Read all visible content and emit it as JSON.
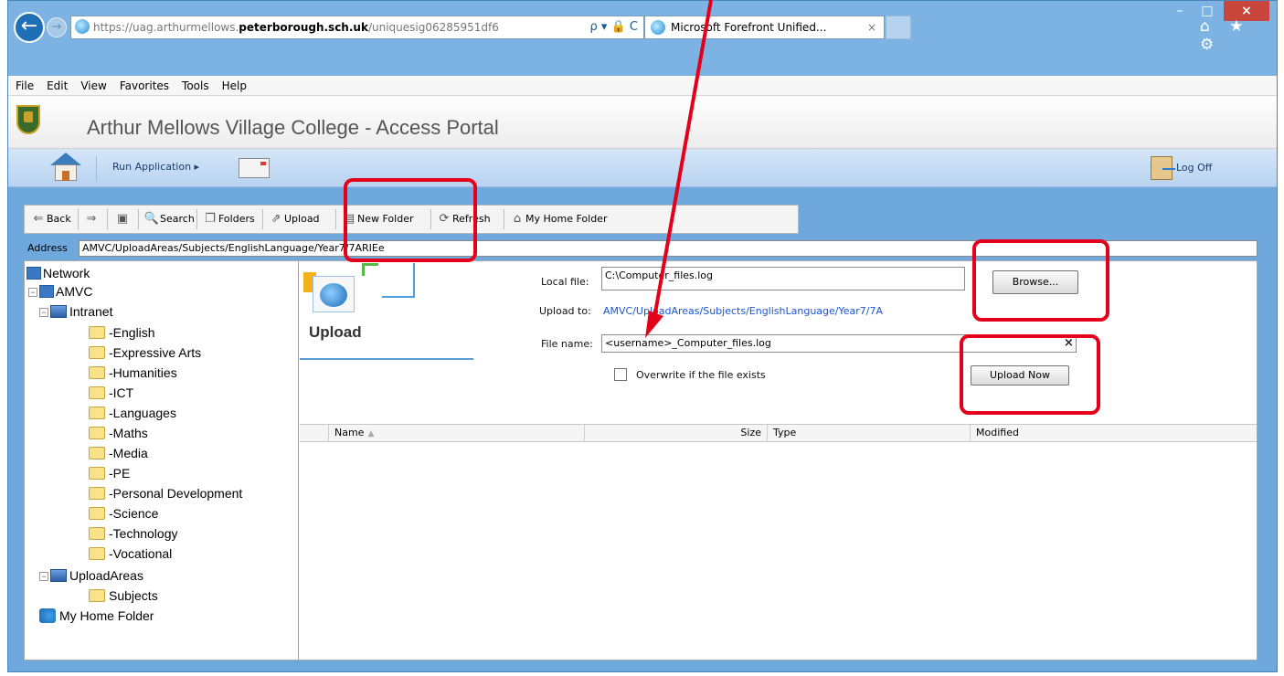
{
  "browser": {
    "url": {
      "scheme": "https://",
      "host_pre": "uag.arthurmellows.",
      "host": "peterborough.sch.uk",
      "path": "/uniquesig06285951df6",
      "controls": "ρ ▾ 🔒 C"
    },
    "tab_title": "Microsoft Forefront Unified...",
    "tab_close": "×",
    "window_controls": {
      "minimize": "–",
      "maximize": "□",
      "close": "×"
    },
    "toolbar_icons": "⌂ ★ ⚙"
  },
  "menu": [
    "File",
    "Edit",
    "View",
    "Favorites",
    "Tools",
    "Help"
  ],
  "portal": {
    "title": "Arthur Mellows Village College - Access Portal",
    "run_application": "Run Application ▸",
    "log_off": "Log Off"
  },
  "toolbar": {
    "back": "Back",
    "search": "Search",
    "folders": "Folders",
    "upload": "Upload",
    "new_folder": "New Folder",
    "refresh": "Refresh",
    "my_home_folder": "My Home Folder"
  },
  "address": {
    "label": "Address",
    "value": "AMVC/UploadAreas/Subjects/EnglishLanguage/Year7/7ARIEe"
  },
  "tree": {
    "network": "Network",
    "amvc": "AMVC",
    "intranet": "Intranet",
    "folders": [
      "-English",
      "-Expressive Arts",
      "-Humanities",
      "-ICT",
      "-Languages",
      "-Maths",
      "-Media",
      "-PE",
      "-Personal Development",
      "-Science",
      "-Technology",
      "-Vocational"
    ],
    "upload_areas": "UploadAreas",
    "subjects": "Subjects",
    "my_home_folder": "My Home Folder"
  },
  "upload": {
    "heading": "Upload",
    "local_file_label": "Local file:",
    "local_file_value": "C:\\Computer_files.log",
    "browse_label": "Browse...",
    "upload_to_label": "Upload to:",
    "upload_to_value": "AMVC/UploadAreas/Subjects/EnglishLanguage/Year7/7A",
    "file_name_label": "File name:",
    "file_name_value": "<username>_Computer_files.log",
    "clear": "×",
    "overwrite_label": "Overwrite if the file exists",
    "upload_now_label": "Upload Now"
  },
  "columns": {
    "name": "Name",
    "size": "Size",
    "type": "Type",
    "modified": "Modified"
  },
  "colors": {
    "annotation": "#e4001b",
    "link": "#1a55d6",
    "window": "#6fa8dc"
  }
}
